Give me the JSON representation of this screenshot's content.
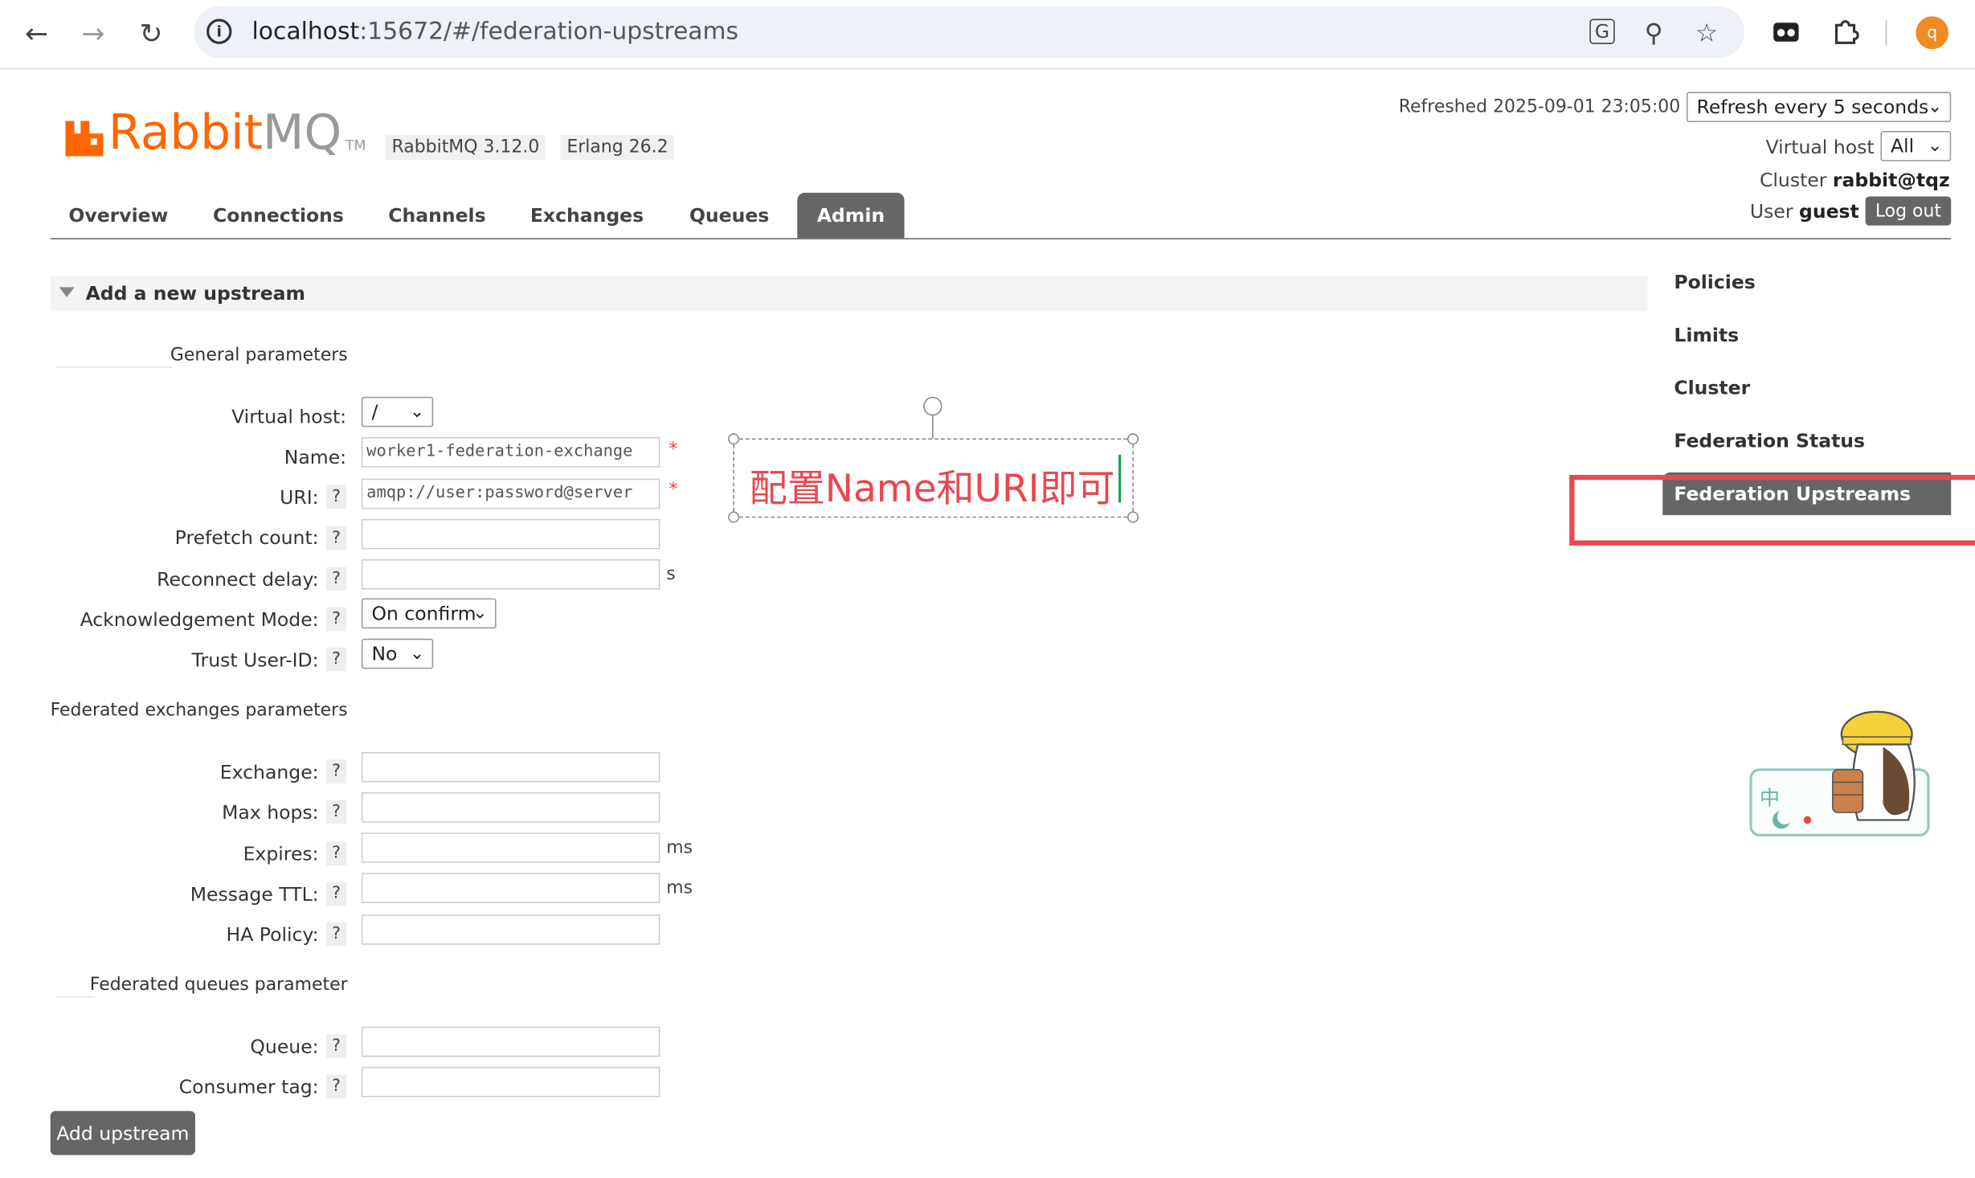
{
  "browser": {
    "url_host": "localhost",
    "url_rest": ":15672/#/federation-upstreams",
    "profile_initial": "q"
  },
  "header": {
    "logo_rabbit": "Rabbit",
    "logo_mq": "MQ",
    "logo_tm": "TM",
    "rabbitmq_version": "RabbitMQ 3.12.0",
    "erlang_version": "Erlang 26.2",
    "refreshed": "Refreshed 2025-09-01 23:05:00",
    "refresh_select": "Refresh every 5 seconds",
    "vhost_label": "Virtual host",
    "vhost_value": "All",
    "cluster_label": "Cluster",
    "cluster_value": "rabbit@tqz",
    "user_label": "User",
    "user_value": "guest",
    "logout_label": "Log out"
  },
  "tabs": [
    {
      "label": "Overview"
    },
    {
      "label": "Connections"
    },
    {
      "label": "Channels"
    },
    {
      "label": "Exchanges"
    },
    {
      "label": "Queues"
    },
    {
      "label": "Admin"
    }
  ],
  "section": {
    "title": "Add a new upstream"
  },
  "groups": {
    "general": "General parameters",
    "exchanges": "Federated exchanges parameters",
    "queues": "Federated queues parameter"
  },
  "form": {
    "virtual_host_label": "Virtual host:",
    "virtual_host_value": "/",
    "name_label": "Name:",
    "name_value": "worker1-federation-exchange",
    "uri_label": "URI:",
    "uri_value": "amqp://user:password@server",
    "prefetch_label": "Prefetch count:",
    "reconnect_label": "Reconnect delay:",
    "reconnect_unit": "s",
    "ack_label": "Acknowledgement Mode:",
    "ack_value": "On confirm",
    "trust_label": "Trust User-ID:",
    "trust_value": "No",
    "exchange_label": "Exchange:",
    "max_hops_label": "Max hops:",
    "expires_label": "Expires:",
    "expires_unit": "ms",
    "ttl_label": "Message TTL:",
    "ttl_unit": "ms",
    "ha_policy_label": "HA Policy:",
    "queue_label": "Queue:",
    "consumer_tag_label": "Consumer tag:",
    "help_glyph": "?",
    "required_glyph": "*",
    "submit_label": "Add upstream"
  },
  "sidebar": {
    "items": [
      {
        "label": "Policies"
      },
      {
        "label": "Limits"
      },
      {
        "label": "Cluster"
      },
      {
        "label": "Federation Status"
      },
      {
        "label": "Federation Upstreams"
      }
    ]
  },
  "annotation": {
    "text": "配置Name和URI即可"
  },
  "ime": {
    "label": "中"
  },
  "colors": {
    "brand": "#ff6600",
    "tab_active": "#666666",
    "annotation": "#e8484f"
  }
}
